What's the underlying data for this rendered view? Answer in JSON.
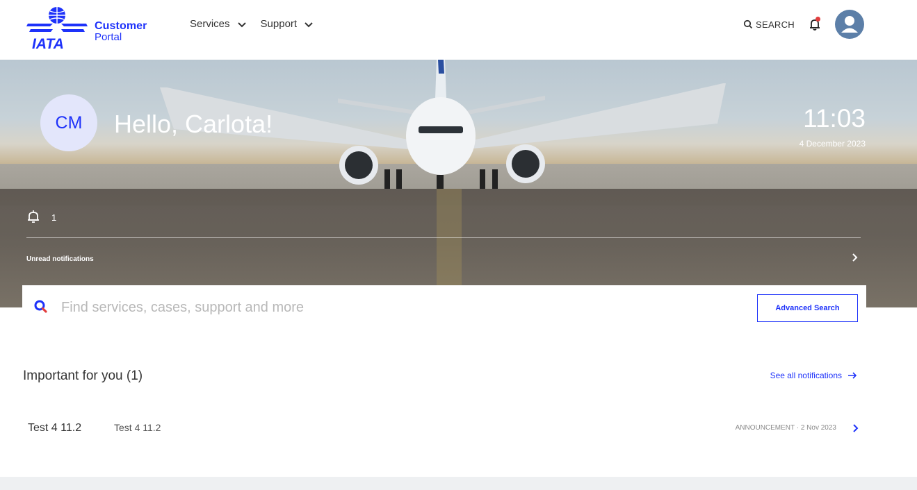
{
  "header": {
    "logo_brand": "IATA",
    "logo_line1": "Customer",
    "logo_line2": "Portal",
    "nav": [
      {
        "label": "Services"
      },
      {
        "label": "Support"
      }
    ],
    "search_label": "SEARCH"
  },
  "hero": {
    "initials": "CM",
    "greeting": "Hello, Carlota!",
    "time": "11:03",
    "date": "4 December 2023",
    "notification_count": "1",
    "unread_label": "Unread notifications"
  },
  "search": {
    "placeholder": "Find services, cases, support and more",
    "advanced_label": "Advanced Search"
  },
  "important": {
    "heading": "Important for you (1)",
    "see_all": "See all notifications",
    "items": [
      {
        "title": "Test 4 11.2",
        "subtitle": "Test 4 11.2",
        "meta": "ANNOUNCEMENT · 2 Nov 2023"
      }
    ]
  },
  "colors": {
    "accent": "#1e32fa",
    "alert_dot": "#e23d3d",
    "avatar_bg": "#5c7fa8",
    "initials_bg": "#e3e6fb",
    "page_bg": "#f4f5f7"
  }
}
